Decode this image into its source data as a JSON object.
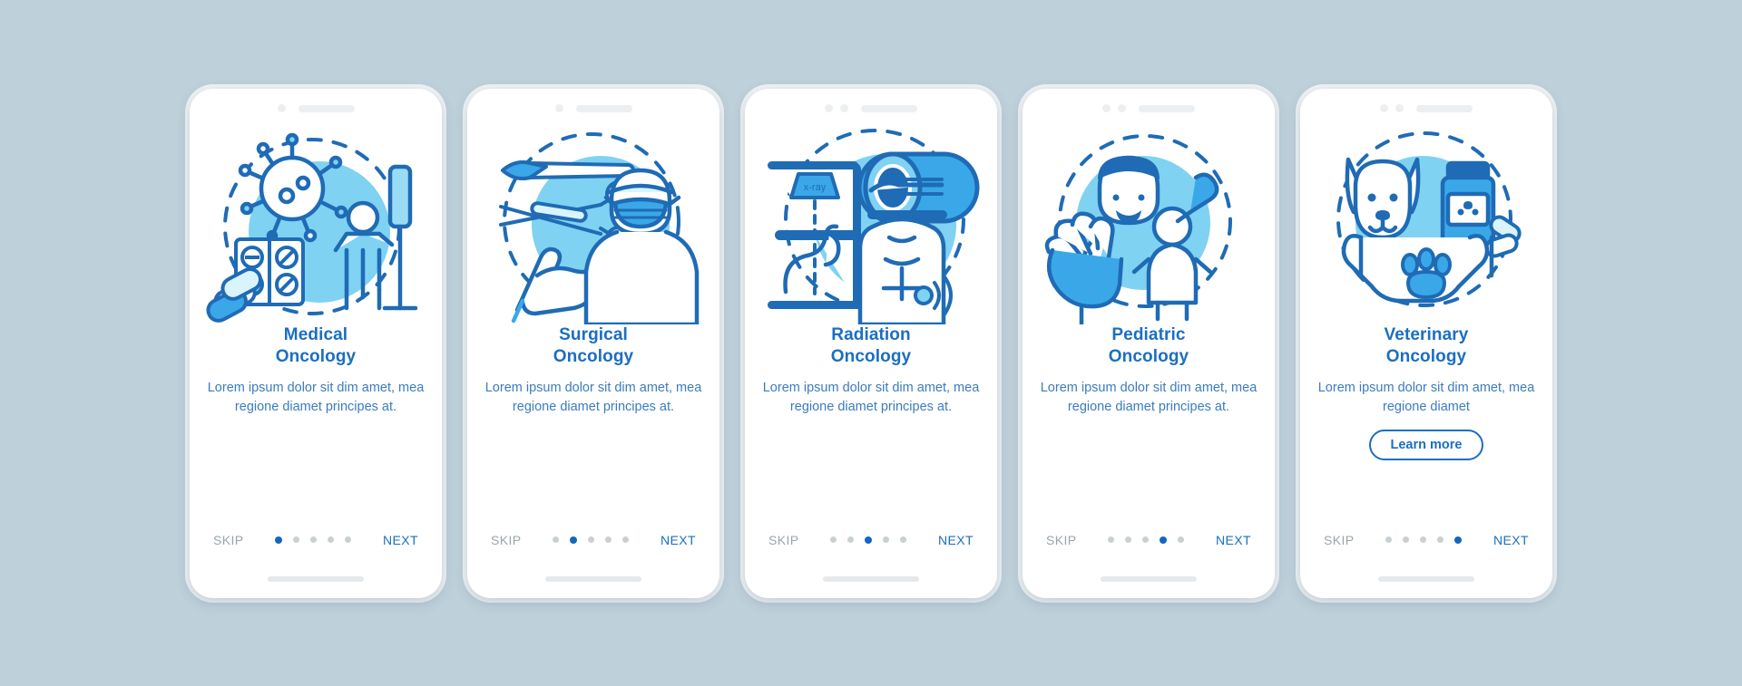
{
  "theme": {
    "background": "#bed0da",
    "phone_surface": "#ffffff",
    "title_color": "#1b6ec2",
    "body_color": "#3b7cbe",
    "accent_dot": "#1466c0",
    "inactive_dot": "#c9d0d4",
    "skip_color": "#9aa5ab",
    "circle_fill": "#7fd2f2",
    "line_color": "#1f6bb5"
  },
  "common": {
    "skip_label": "SKIP",
    "next_label": "NEXT",
    "total_dots": 5,
    "xray_label": "x-ray"
  },
  "screens": [
    {
      "id": "medical-oncology",
      "title_line1": "Medical",
      "title_line2": "Oncology",
      "description": "Lorem ipsum dolor sit dim amet, mea regione diamet principes at.",
      "active_dot": 1,
      "camera_dots": 1,
      "has_learn_more": false,
      "learn_more_label": "",
      "illustration": "virus-pills-patient-iv"
    },
    {
      "id": "surgical-oncology",
      "title_line1": "Surgical",
      "title_line2": "Oncology",
      "description": "Lorem ipsum dolor sit dim amet, mea regione diamet principes at.",
      "active_dot": 2,
      "camera_dots": 1,
      "has_learn_more": false,
      "learn_more_label": "",
      "illustration": "scalpel-scissors-surgeon"
    },
    {
      "id": "radiation-oncology",
      "title_line1": "Radiation",
      "title_line2": "Oncology",
      "description": "Lorem ipsum dolor sit dim amet, mea regione diamet principes at.",
      "active_dot": 3,
      "camera_dots": 2,
      "has_learn_more": false,
      "learn_more_label": "",
      "illustration": "xray-machine-ct-scanner-torso"
    },
    {
      "id": "pediatric-oncology",
      "title_line1": "Pediatric",
      "title_line2": "Oncology",
      "description": "Lorem ipsum dolor sit dim amet, mea regione diamet principes at.",
      "active_dot": 4,
      "camera_dots": 2,
      "has_learn_more": false,
      "learn_more_label": "",
      "illustration": "doctor-child-hand"
    },
    {
      "id": "veterinary-oncology",
      "title_line1": "Veterinary",
      "title_line2": "Oncology",
      "description": "Lorem ipsum dolor sit dim amet, mea regione diamet",
      "active_dot": 5,
      "camera_dots": 2,
      "has_learn_more": true,
      "learn_more_label": "Learn more",
      "illustration": "dog-pill-bottle-paw-hands"
    }
  ]
}
